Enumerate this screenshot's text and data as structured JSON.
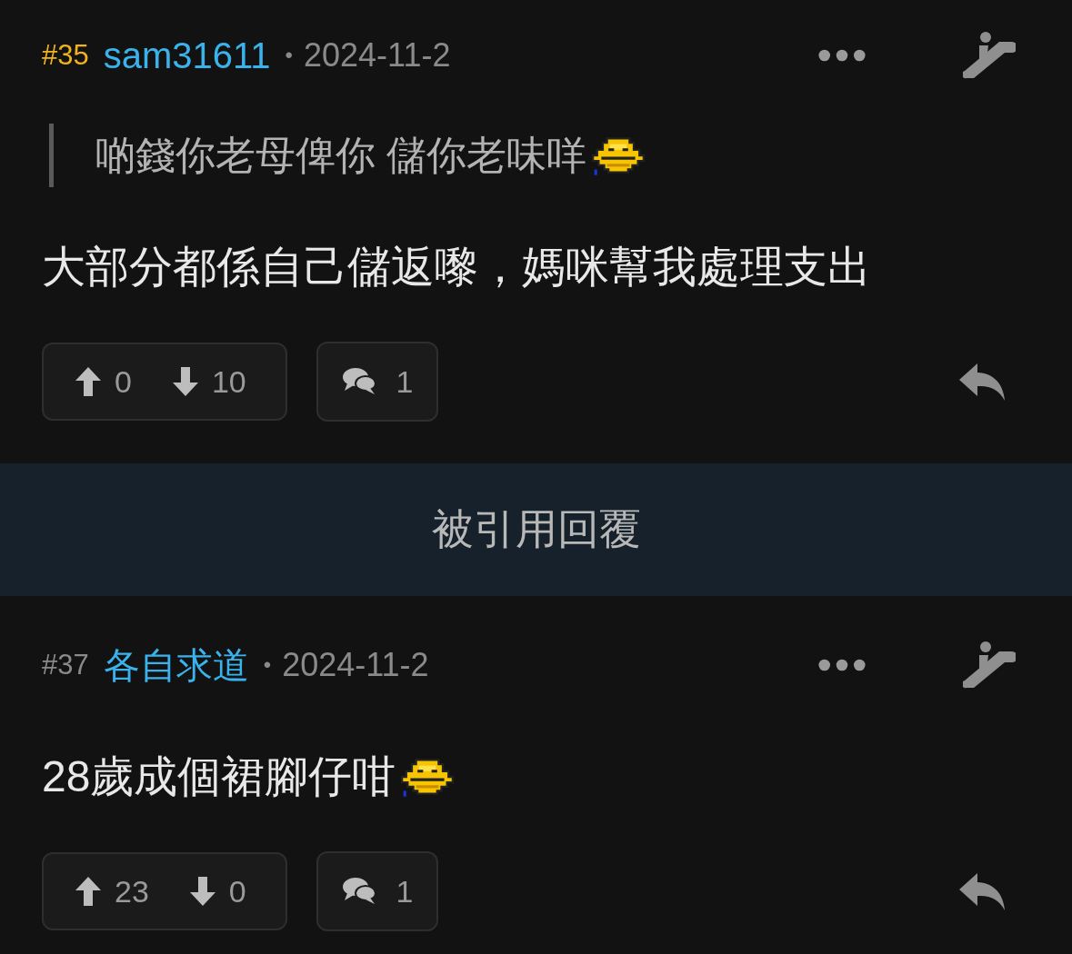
{
  "posts": [
    {
      "number": "#35",
      "highlighted": true,
      "author": "sam31611",
      "separator": "•",
      "date": "2024-11-2",
      "quote": {
        "text": "啲錢你老母俾你 儲你老味咩",
        "emoji": true
      },
      "body": {
        "text": "大部分都係自己儲返嚟，媽咪幫我處理支出",
        "emoji": false
      },
      "upvotes": "0",
      "downvotes": "10",
      "comments": "1"
    },
    {
      "kind": "quoted_bar",
      "label": "被引用回覆"
    },
    {
      "number": "#37",
      "highlighted": false,
      "author": "各自求道",
      "separator": "•",
      "date": "2024-11-2",
      "body": {
        "text": "28歲成個裙腳仔咁",
        "emoji": true
      },
      "upvotes": "23",
      "downvotes": "0",
      "comments": "1"
    }
  ]
}
